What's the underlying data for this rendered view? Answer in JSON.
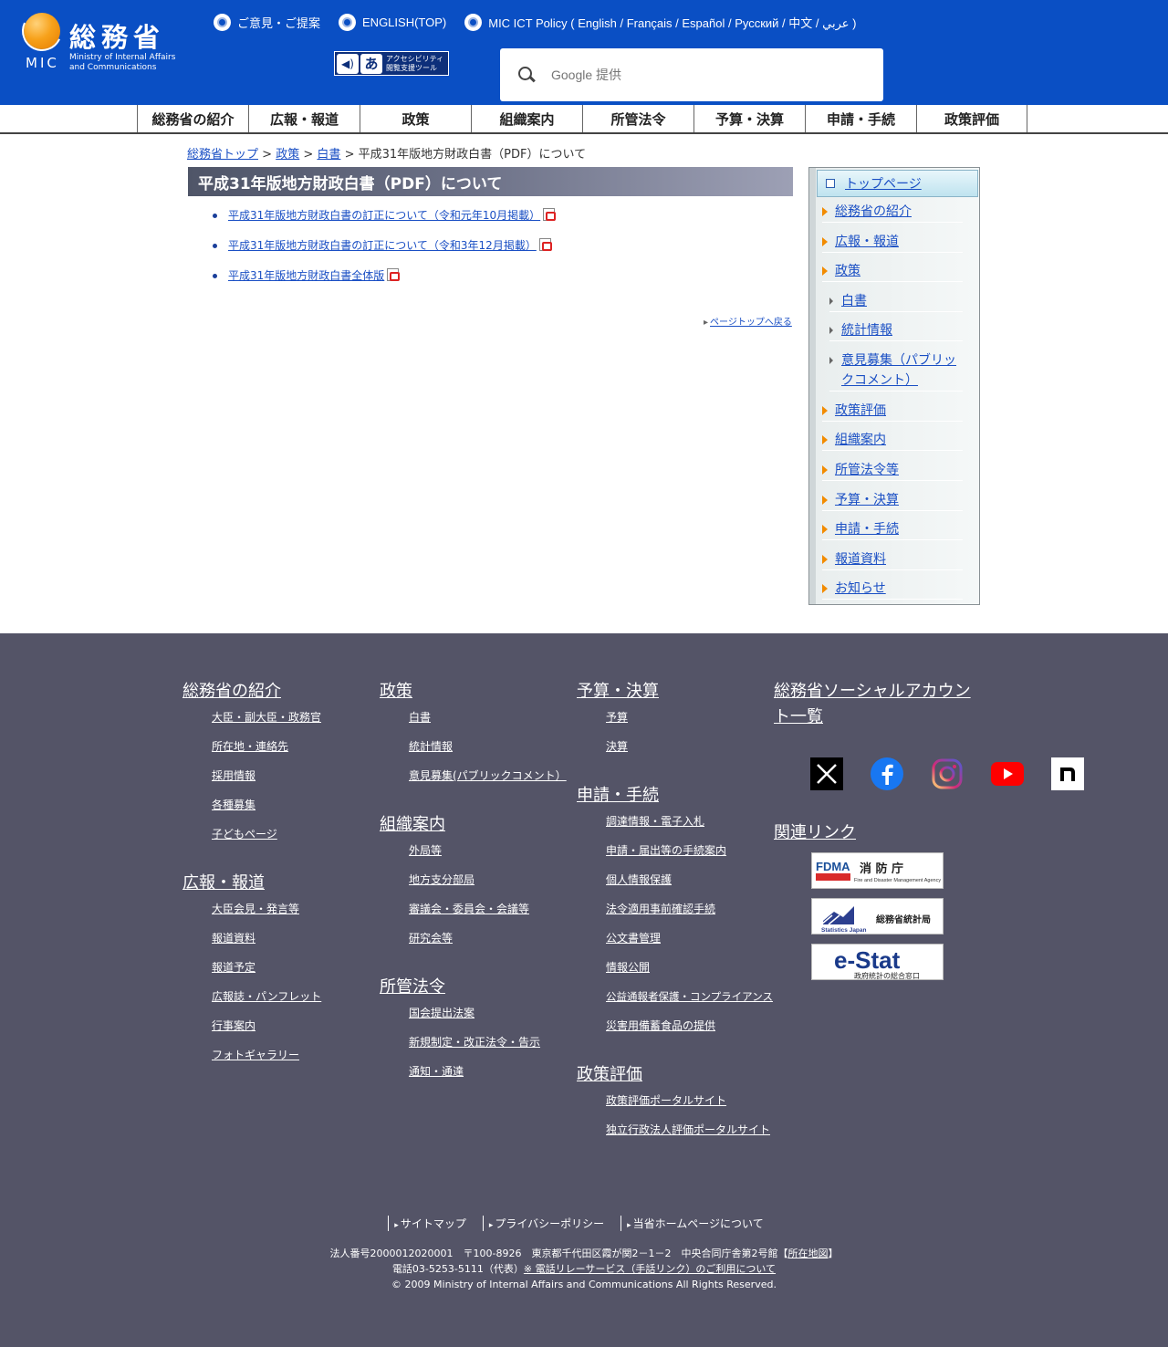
{
  "header": {
    "logo_kanji": "総務省",
    "logo_abbr": "MIC",
    "logo_en_line1": "Ministry of Internal Affairs",
    "logo_en_line2": "and Communications",
    "top_links": [
      {
        "label": "ご意見・ご提案"
      },
      {
        "label": "ENGLISH(TOP)"
      },
      {
        "label": "MIC ICT Policy ( English / Français / Español / Русский / 中文 / عربي )"
      }
    ],
    "a11y_tool_line1": "アクセシビリティ",
    "a11y_tool_line2": "閲覧支援ツール",
    "a11y_a_glyph": "あ",
    "search_placeholder": "Google 提供"
  },
  "gnav": [
    {
      "label": "総務省の紹介"
    },
    {
      "label": "広報・報道"
    },
    {
      "label": "政策"
    },
    {
      "label": "組織案内"
    },
    {
      "label": "所管法令"
    },
    {
      "label": "予算・決算"
    },
    {
      "label": "申請・手続"
    },
    {
      "label": "政策評価"
    }
  ],
  "breadcrumb": {
    "home": "総務省トップ",
    "sep": ">",
    "policy": "政策",
    "whitepaper": "白書",
    "current": "平成31年版地方財政白書（PDF）について"
  },
  "main": {
    "title": "平成31年版地方財政白書（PDF）について",
    "docs": [
      {
        "label": "平成31年版地方財政白書の訂正について（令和元年10月掲載）"
      },
      {
        "label": "平成31年版地方財政白書の訂正について（令和3年12月掲載）"
      },
      {
        "label": "平成31年版地方財政白書全体版"
      }
    ],
    "pagetop": "ページトップへ戻る"
  },
  "sidenav": {
    "top": "トップページ",
    "items": [
      {
        "label": "総務省の紹介"
      },
      {
        "label": "広報・報道"
      },
      {
        "label": "政策"
      }
    ],
    "sub": [
      {
        "label": "白書"
      },
      {
        "label": "統計情報"
      },
      {
        "label": "意見募集（パブリックコメント）"
      }
    ],
    "items2": [
      {
        "label": "政策評価"
      },
      {
        "label": "組織案内"
      },
      {
        "label": "所管法令等"
      },
      {
        "label": "予算・決算"
      },
      {
        "label": "申請・手続"
      },
      {
        "label": "報道資料"
      },
      {
        "label": "お知らせ"
      }
    ]
  },
  "footer": {
    "col1": {
      "head1": "総務省の紹介",
      "links1": [
        "大臣・副大臣・政務官",
        "所在地・連絡先",
        "採用情報",
        "各種募集",
        "子どもページ"
      ],
      "head2": "広報・報道",
      "links2": [
        "大臣会見・発言等",
        "報道資料",
        "報道予定",
        "広報誌・パンフレット",
        "行事案内",
        "フォトギャラリー"
      ]
    },
    "col2": {
      "head1": "政策",
      "links1": [
        "白書",
        "統計情報",
        "意見募集(パブリックコメント）"
      ],
      "head2": "組織案内",
      "links2": [
        "外局等",
        "地方支分部局",
        "審議会・委員会・会議等",
        "研究会等"
      ],
      "head3": "所管法令",
      "links3": [
        "国会提出法案",
        "新規制定・改正法令・告示",
        "通知・通達"
      ]
    },
    "col3": {
      "head1": "予算・決算",
      "links1": [
        "予算",
        "決算"
      ],
      "head2": "申請・手続",
      "links2": [
        "調達情報・電子入札",
        "申請・届出等の手続案内",
        "個人情報保護",
        "法令適用事前確認手続",
        "公文書管理",
        "情報公開",
        "公益通報者保護・コンプライアンス",
        "災害用備蓄食品の提供"
      ],
      "head3": "政策評価",
      "links3": [
        "政策評価ポータルサイト",
        "独立行政法人評価ポータルサイト"
      ]
    },
    "col4": {
      "head1": "総務省ソーシャルアカウント一覧",
      "head2": "関連リンク",
      "social": [
        "x-icon",
        "facebook-icon",
        "instagram-icon",
        "youtube-icon",
        "note-icon"
      ],
      "banner_fdma_abbr": "FDMA",
      "banner_fdma_name": "消 防 庁",
      "banner_fdma_en": "Fire and Disaster Management Agency",
      "banner_stat_name": "総務省統計局",
      "banner_stat_en": "Statistics Japan",
      "banner_estat": "e-Stat",
      "banner_estat_sub": "政府統計の総合窓口"
    },
    "bottom_links": [
      "サイトマップ",
      "プライバシーポリシー",
      "当省ホームページについて"
    ],
    "addr1_prefix": "法人番号2000012020001　〒100-8926　東京都千代田区霞が関2－1－2　中央合同庁舎第2号館【",
    "addr1_link": "所在地図",
    "addr1_suffix": "】",
    "addr2_prefix": "電話03-5253-5111（代表）",
    "addr2_link": "※ 電話リレーサービス（手話リンク）のご利用について",
    "copyright": "© 2009 Ministry of Internal Affairs and Communications All Rights Reserved."
  },
  "colors": {
    "header_blue": "#0a4fc4",
    "footer_bg": "#545467",
    "accent_orange": "#f28b00"
  }
}
